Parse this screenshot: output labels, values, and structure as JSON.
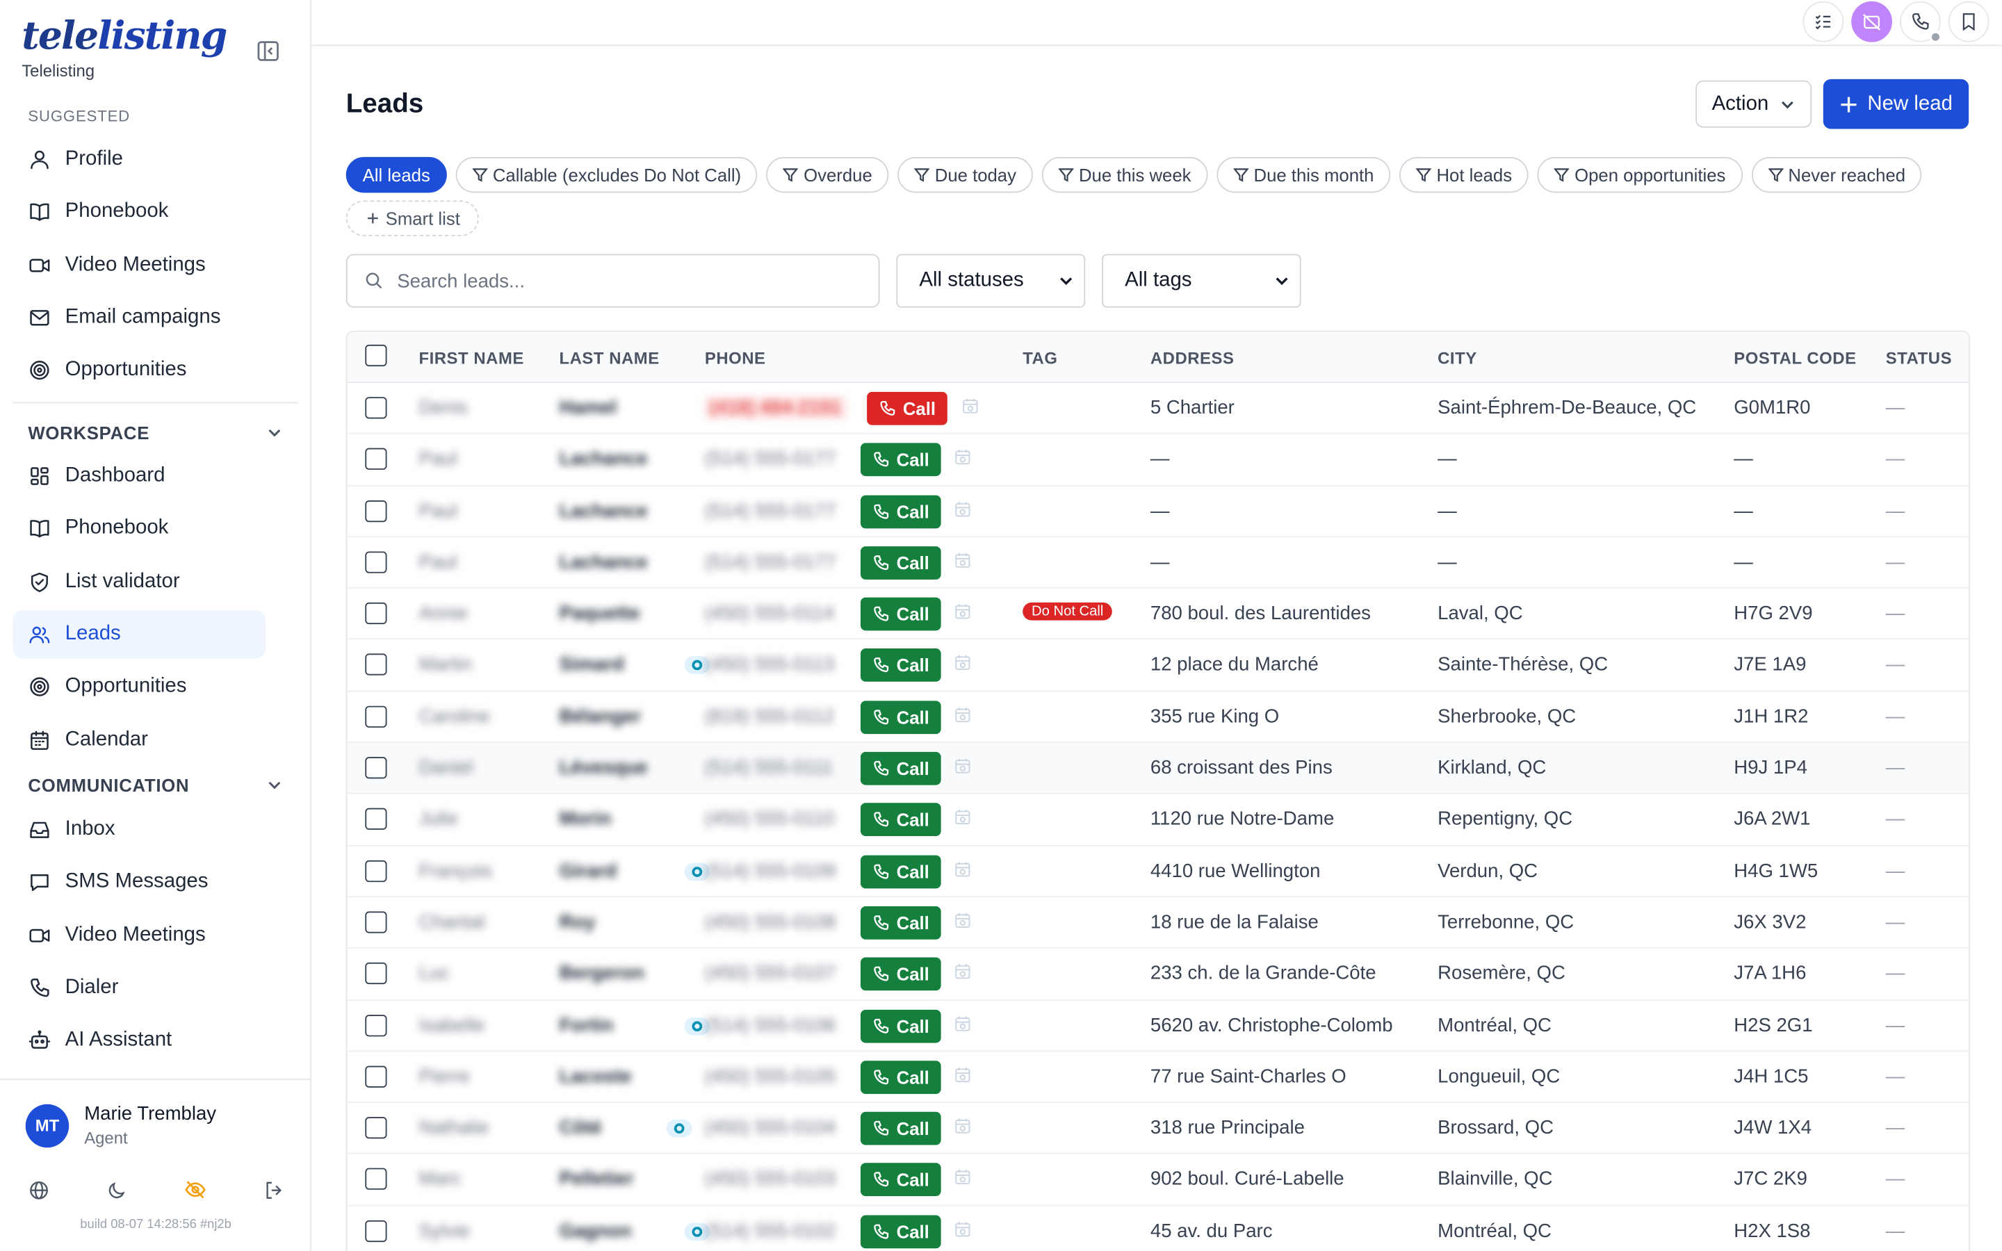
{
  "brand": {
    "logo_tele": "tele",
    "logo_listing": "listing",
    "subtitle": "Telelisting"
  },
  "sidebar": {
    "suggested_label": "SUGGESTED",
    "suggested": [
      {
        "label": "Profile",
        "icon": "user-icon"
      },
      {
        "label": "Phonebook",
        "icon": "book-icon"
      },
      {
        "label": "Video Meetings",
        "icon": "video-icon"
      },
      {
        "label": "Email campaigns",
        "icon": "mail-icon"
      },
      {
        "label": "Opportunities",
        "icon": "target-icon"
      }
    ],
    "workspace_label": "WORKSPACE",
    "workspace": [
      {
        "label": "Dashboard",
        "icon": "dashboard-icon"
      },
      {
        "label": "Phonebook",
        "icon": "book-icon"
      },
      {
        "label": "List validator",
        "icon": "shield-check-icon"
      },
      {
        "label": "Leads",
        "icon": "users-icon",
        "active": true
      },
      {
        "label": "Opportunities",
        "icon": "target-icon"
      },
      {
        "label": "Calendar",
        "icon": "calendar-icon"
      }
    ],
    "communication_label": "COMMUNICATION",
    "communication": [
      {
        "label": "Inbox",
        "icon": "inbox-icon"
      },
      {
        "label": "SMS Messages",
        "icon": "message-icon"
      },
      {
        "label": "Video Meetings",
        "icon": "video-icon"
      },
      {
        "label": "Dialer",
        "icon": "phone-icon"
      },
      {
        "label": "AI Assistant",
        "icon": "bot-icon"
      }
    ],
    "user": {
      "initials": "MT",
      "name": "Marie Tremblay",
      "role": "Agent"
    },
    "build": "build 08-07 14:28:56 #nj2b"
  },
  "header": {
    "title": "Leads",
    "action_label": "Action",
    "new_lead_label": "New lead"
  },
  "filters": [
    "All leads",
    "Callable (excludes Do Not Call)",
    "Overdue",
    "Due today",
    "Due this week",
    "Due this month",
    "Hot leads",
    "Open opportunities",
    "Never reached"
  ],
  "smart_list_label": "Smart list",
  "search": {
    "placeholder": "Search leads...",
    "value": ""
  },
  "status_select": "All statuses",
  "tags_select": "All tags",
  "table": {
    "headers": [
      "FIRST NAME",
      "LAST NAME",
      "PHONE",
      "TAG",
      "ADDRESS",
      "CITY",
      "POSTAL CODE",
      "STATUS"
    ],
    "call_label": "Call",
    "rows": [
      {
        "first": "Denis",
        "last": "Hamel",
        "phone": "(418) 484-2191",
        "tag": "",
        "address": "5 Chartier",
        "city": "Saint-Éphrem-De-Beauce, QC",
        "postal": "G0M1R0",
        "status": "—",
        "dnc": true,
        "ai": false
      },
      {
        "first": "Paul",
        "last": "Lachance",
        "phone": "(514) 555-0177",
        "tag": "",
        "address": "—",
        "city": "—",
        "postal": "—",
        "status": "—",
        "dnc": false,
        "ai": false
      },
      {
        "first": "Paul",
        "last": "Lachance",
        "phone": "(514) 555-0177",
        "tag": "",
        "address": "—",
        "city": "—",
        "postal": "—",
        "status": "—",
        "dnc": false,
        "ai": false
      },
      {
        "first": "Paul",
        "last": "Lachance",
        "phone": "(514) 555-0177",
        "tag": "",
        "address": "—",
        "city": "—",
        "postal": "—",
        "status": "—",
        "dnc": false,
        "ai": false
      },
      {
        "first": "Annie",
        "last": "Paquette",
        "phone": "(450) 555-0114",
        "tag": "Do Not Call",
        "address": "780 boul. des Laurentides",
        "city": "Laval, QC",
        "postal": "H7G 2V9",
        "status": "—",
        "dnc": false,
        "ai": false
      },
      {
        "first": "Martin",
        "last": "Simard",
        "phone": "(450) 555-0113",
        "tag": "",
        "address": "12 place du Marché",
        "city": "Sainte-Thérèse, QC",
        "postal": "J7E 1A9",
        "status": "—",
        "dnc": false,
        "ai": true
      },
      {
        "first": "Caroline",
        "last": "Bélanger",
        "phone": "(819) 555-0112",
        "tag": "",
        "address": "355 rue King O",
        "city": "Sherbrooke, QC",
        "postal": "J1H 1R2",
        "status": "—",
        "dnc": false,
        "ai": false
      },
      {
        "first": "Daniel",
        "last": "Lévesque",
        "phone": "(514) 555-0111",
        "tag": "",
        "address": "68 croissant des Pins",
        "city": "Kirkland, QC",
        "postal": "H9J 1P4",
        "status": "—",
        "dnc": false,
        "ai": false,
        "hover": true
      },
      {
        "first": "Julie",
        "last": "Morin",
        "phone": "(450) 555-0110",
        "tag": "",
        "address": "1120 rue Notre-Dame",
        "city": "Repentigny, QC",
        "postal": "J6A 2W1",
        "status": "—",
        "dnc": false,
        "ai": false
      },
      {
        "first": "François",
        "last": "Girard",
        "phone": "(514) 555-0109",
        "tag": "",
        "address": "4410 rue Wellington",
        "city": "Verdun, QC",
        "postal": "H4G 1W5",
        "status": "—",
        "dnc": false,
        "ai": true
      },
      {
        "first": "Chantal",
        "last": "Roy",
        "phone": "(450) 555-0108",
        "tag": "",
        "address": "18 rue de la Falaise",
        "city": "Terrebonne, QC",
        "postal": "J6X 3V2",
        "status": "—",
        "dnc": false,
        "ai": false
      },
      {
        "first": "Luc",
        "last": "Bergeron",
        "phone": "(450) 555-0107",
        "tag": "",
        "address": "233 ch. de la Grande-Côte",
        "city": "Rosemère, QC",
        "postal": "J7A 1H6",
        "status": "—",
        "dnc": false,
        "ai": false
      },
      {
        "first": "Isabelle",
        "last": "Fortin",
        "phone": "(514) 555-0106",
        "tag": "",
        "address": "5620 av. Christophe-Colomb",
        "city": "Montréal, QC",
        "postal": "H2S 2G1",
        "status": "—",
        "dnc": false,
        "ai": true
      },
      {
        "first": "Pierre",
        "last": "Lacoste",
        "phone": "(450) 555-0105",
        "tag": "",
        "address": "77 rue Saint-Charles O",
        "city": "Longueuil, QC",
        "postal": "J4H 1C5",
        "status": "—",
        "dnc": false,
        "ai": false
      },
      {
        "first": "Nathalie",
        "last": "Côté",
        "phone": "(450) 555-0104",
        "tag": "",
        "address": "318 rue Principale",
        "city": "Brossard, QC",
        "postal": "J4W 1X4",
        "status": "—",
        "dnc": false,
        "ai": true
      },
      {
        "first": "Marc",
        "last": "Pelletier",
        "phone": "(450) 555-0103",
        "tag": "",
        "address": "902 boul. Curé-Labelle",
        "city": "Blainville, QC",
        "postal": "J7C 2K9",
        "status": "—",
        "dnc": false,
        "ai": false
      },
      {
        "first": "Sylvie",
        "last": "Gagnon",
        "phone": "(514) 555-0102",
        "tag": "",
        "address": "45 av. du Parc",
        "city": "Montréal, QC",
        "postal": "H2X 1S8",
        "status": "—",
        "dnc": false,
        "ai": true
      }
    ]
  },
  "colors": {
    "primary": "#1d4ed8",
    "call_green": "#15803d",
    "call_red": "#dc2626",
    "accent_purple": "#c084fc"
  }
}
